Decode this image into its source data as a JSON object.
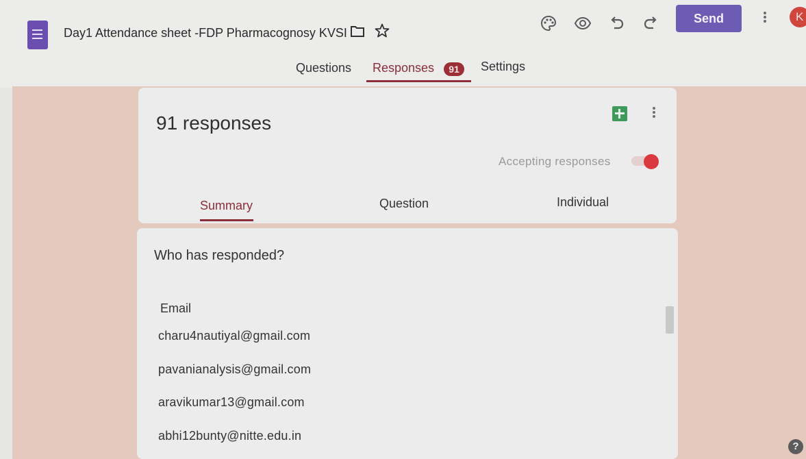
{
  "header": {
    "title": "Day1 Attendance sheet -FDP Pharmacognosy KVSI",
    "send_label": "Send",
    "avatar_letter": "K",
    "tabs": [
      {
        "label": "Questions"
      },
      {
        "label": "Responses"
      },
      {
        "label": "Settings"
      }
    ],
    "responses_badge": "91",
    "icons": [
      "form-doc-icon",
      "folder-icon",
      "star-icon",
      "palette-icon",
      "preview-eye-icon",
      "undo-icon",
      "redo-icon",
      "more-vert-icon"
    ]
  },
  "summary_card": {
    "count_label": "91 responses",
    "accepting_label": "Accepting responses",
    "subtabs": [
      {
        "label": "Summary"
      },
      {
        "label": "Question"
      },
      {
        "label": "Individual"
      }
    ],
    "icons": [
      "sheets-icon",
      "more-vert-icon"
    ]
  },
  "who_card": {
    "heading": "Who has responded?",
    "column_header": "Email",
    "emails": [
      "charu4nautiyal@gmail.com",
      "pavanianalysis@gmail.com",
      "aravikumar13@gmail.com",
      "abhi12bunty@nitte.edu.in"
    ]
  },
  "help_label": "?",
  "colors": {
    "brand_purple": "#6d5cb3",
    "accent_maroon": "#8b2e3a",
    "background_pink": "#e3c9be",
    "toggle_red": "#d9393f"
  }
}
